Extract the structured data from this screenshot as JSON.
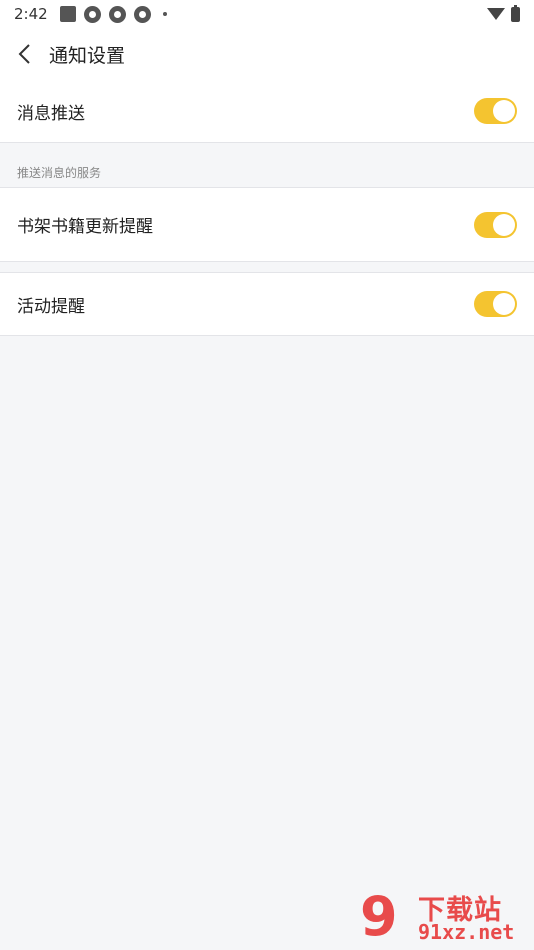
{
  "status_bar": {
    "time": "2:42"
  },
  "header": {
    "title": "通知设置"
  },
  "settings": {
    "push": {
      "label": "消息推送",
      "enabled": true
    },
    "section_title": "推送消息的服务",
    "shelf_update": {
      "label": "书架书籍更新提醒",
      "enabled": true
    },
    "activity": {
      "label": "活动提醒",
      "enabled": true
    }
  },
  "colors": {
    "toggle_on": "#f4c430",
    "background": "#f5f6f8",
    "watermark": "#e84b4b"
  },
  "watermark": {
    "logo_number": "9",
    "top_text": "下载站",
    "bottom_text": "91xz.net"
  }
}
